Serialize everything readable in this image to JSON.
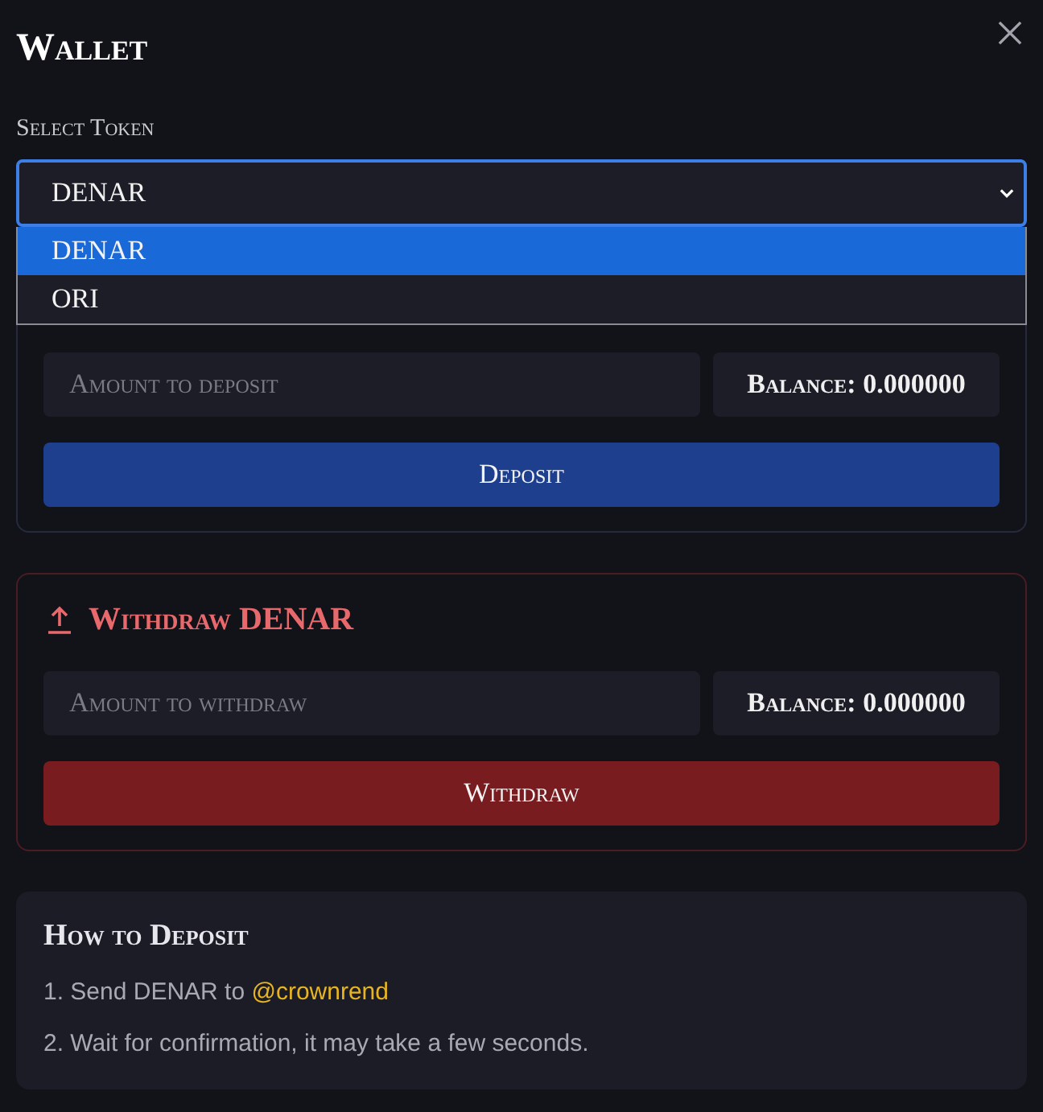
{
  "dialog": {
    "title": "Wallet"
  },
  "token_select": {
    "label": "Select Token",
    "value": "DENAR",
    "expanded": true,
    "options": [
      {
        "label": "DENAR",
        "selected": true
      },
      {
        "label": "ORI",
        "selected": false
      }
    ]
  },
  "deposit_panel": {
    "amount_field": {
      "placeholder": "Amount to deposit"
    },
    "balance": "Balance: 0.000000",
    "button": "Deposit"
  },
  "withdraw_panel": {
    "heading": "Withdraw DENAR",
    "amount_field": {
      "placeholder": "Amount to withdraw"
    },
    "balance": "Balance: 0.000000",
    "button": "Withdraw"
  },
  "instructions": {
    "heading": "How to Deposit",
    "steps": [
      {
        "text": "1. Send DENAR to",
        "handle": "@crownrend"
      },
      {
        "text": "2. Wait for confirmation, it may take a few seconds."
      }
    ]
  }
}
